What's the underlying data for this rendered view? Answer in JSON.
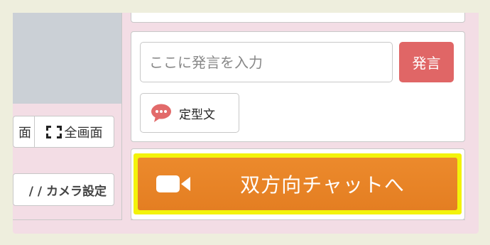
{
  "left": {
    "view_left_label": "面",
    "fullscreen_label": "全画面",
    "camera_settings_label": "/ / カメラ設定"
  },
  "chat": {
    "input_placeholder": "ここに発言を入力",
    "input_value": "",
    "send_label": "発言",
    "template_label": "定型文"
  },
  "bidirectional": {
    "label": "双方向チャットへ"
  },
  "colors": {
    "frame_bg": "#f3dde5",
    "send_button": "#e06666",
    "bidir_button": "#e8852a",
    "highlight": "#f3f30a",
    "bubble_icon": "#e26a6a"
  },
  "icons": {
    "fullscreen": "fullscreen-icon",
    "template": "speech-bubble-icon",
    "bidirectional": "video-camera-icon"
  }
}
